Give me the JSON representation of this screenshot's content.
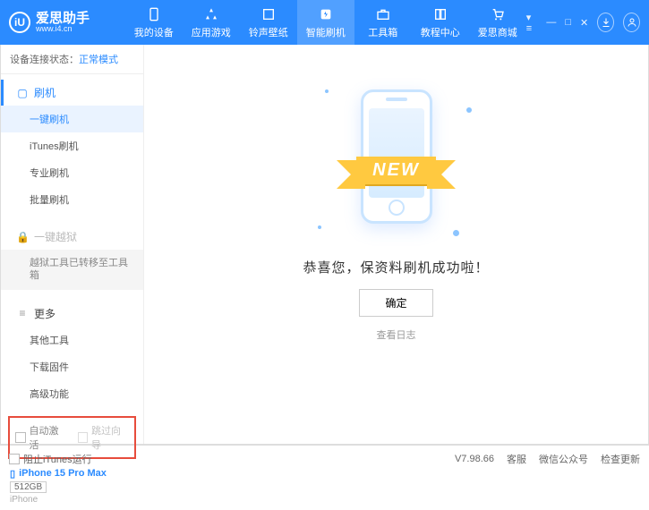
{
  "brand": {
    "name": "爱思助手",
    "url": "www.i4.cn",
    "logo_letter": "iU"
  },
  "topnav": {
    "items": [
      {
        "label": "我的设备"
      },
      {
        "label": "应用游戏"
      },
      {
        "label": "铃声壁纸"
      },
      {
        "label": "智能刷机"
      },
      {
        "label": "工具箱"
      },
      {
        "label": "教程中心"
      },
      {
        "label": "爱思商城"
      }
    ],
    "active_index": 3
  },
  "status": {
    "prefix": "设备连接状态：",
    "value": "正常模式"
  },
  "sidebar": {
    "flash": {
      "title": "刷机",
      "items": [
        "一键刷机",
        "iTunes刷机",
        "专业刷机",
        "批量刷机"
      ],
      "active_index": 0
    },
    "jailbreak": {
      "title": "一键越狱",
      "note": "越狱工具已转移至工具箱"
    },
    "more": {
      "title": "更多",
      "items": [
        "其他工具",
        "下载固件",
        "高级功能"
      ]
    }
  },
  "options": {
    "auto_activate": "自动激活",
    "skip_guide": "跳过向导"
  },
  "device": {
    "name": "iPhone 15 Pro Max",
    "capacity": "512GB",
    "type": "iPhone"
  },
  "main": {
    "ribbon": "NEW",
    "success": "恭喜您，保资料刷机成功啦！",
    "ok": "确定",
    "view_log": "查看日志"
  },
  "footer": {
    "block_itunes": "阻止iTunes运行",
    "version": "V7.98.66",
    "links": [
      "客服",
      "微信公众号",
      "检查更新"
    ]
  }
}
